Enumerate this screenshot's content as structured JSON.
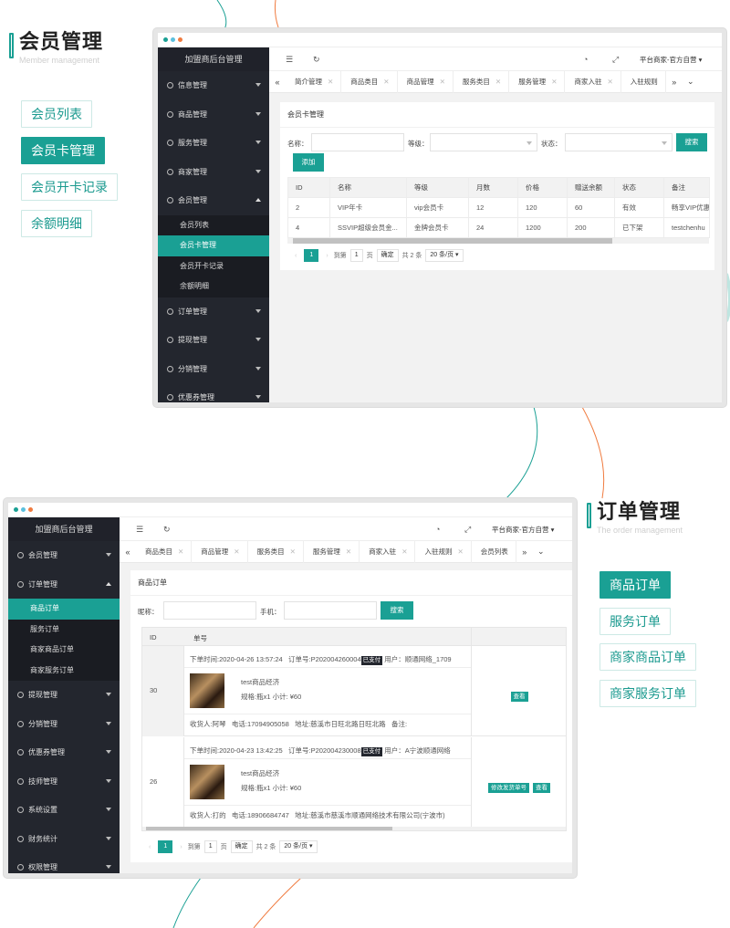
{
  "section1": {
    "title": "会员管理",
    "subtitle": "Member management",
    "tags": [
      "会员列表",
      "会员卡管理",
      "会员开卡记录",
      "余额明细"
    ]
  },
  "section2": {
    "title": "订单管理",
    "subtitle": "The order management",
    "tags": [
      "商品订单",
      "服务订单",
      "商家商品订单",
      "商家服务订单"
    ]
  },
  "colors": {
    "accent": "#1aa094",
    "sidebar": "#23262e",
    "orange": "#f07b3f"
  },
  "win1": {
    "brand": "加盟商后台管理",
    "nav": [
      "信息管理",
      "商品管理",
      "服务管理",
      "商家管理",
      "会员管理"
    ],
    "sub": [
      "会员列表",
      "会员卡管理",
      "会员开卡记录",
      "余额明细"
    ],
    "nav2": [
      "订单管理",
      "提现管理",
      "分销管理",
      "优惠券管理"
    ],
    "user": "平台商家-官方自营",
    "tabs": [
      "简介管理",
      "商品类目",
      "商品管理",
      "服务类目",
      "服务管理",
      "商家入驻",
      "入驻规则"
    ],
    "panel_title": "会员卡管理",
    "labels": {
      "name": "名称：",
      "level": "等级：",
      "status": "状态：",
      "search": "搜索",
      "add": "添加"
    },
    "table": {
      "headers": [
        "ID",
        "名称",
        "等级",
        "月数",
        "价格",
        "赠送余额",
        "状态",
        "备注"
      ],
      "rows": [
        [
          "2",
          "VIP年卡",
          "vip会员卡",
          "12",
          "120",
          "60",
          "有效",
          "畅享VIP优惠"
        ],
        [
          "4",
          "SSVIP超级会员金...",
          "金牌会员卡",
          "24",
          "1200",
          "200",
          "已下架",
          "testchenhu"
        ]
      ]
    },
    "pager": {
      "page": "1",
      "goto": "到第",
      "page_input": "1",
      "page_unit": "页",
      "confirm": "确定",
      "total": "共 2 条",
      "per": "20 条/页"
    }
  },
  "win2": {
    "brand": "加盟商后台管理",
    "nav": [
      "会员管理",
      "订单管理"
    ],
    "sub": [
      "商品订单",
      "服务订单",
      "商家商品订单",
      "商家服务订单"
    ],
    "nav2": [
      "提现管理",
      "分销管理",
      "优惠券管理",
      "技师管理",
      "系统设置",
      "财务统计",
      "权限管理"
    ],
    "user": "平台商家-官方自营",
    "tabs": [
      "商品类目",
      "商品管理",
      "服务类目",
      "服务管理",
      "商家入驻",
      "入驻规则",
      "会员列表"
    ],
    "panel_title": "商品订单",
    "labels": {
      "nick": "昵称：",
      "phone": "手机：",
      "search": "搜索"
    },
    "headers": [
      "ID",
      "单号"
    ],
    "orders": [
      {
        "id": "30",
        "time": "下单时间:2020-04-26 13:57:24",
        "no": "订单号:P202004260004",
        "paid": "已支付",
        "user": "用户：顺通网络_1709",
        "product": "test商品经济",
        "spec": "规格:瓶x1 小计: ¥60",
        "receiver": "收货人:阿琴",
        "tel": "电话:17094905058",
        "addr": "地址:慈溪市日旺北路日旺北路",
        "note": "备注:",
        "btns": [
          "查看"
        ]
      },
      {
        "id": "26",
        "time": "下单时间:2020-04-23 13:42:25",
        "no": "订单号:P202004230008",
        "paid": "已支付",
        "user": "用户：A宁波顺通网络",
        "product": "test商品经济",
        "spec": "规格:瓶x1 小计: ¥60",
        "receiver": "收货人:打的",
        "tel": "电话:18906684747",
        "addr": "地址:慈溪市慈溪市顺通网络技术有限公司(宁波市)",
        "note": "",
        "btns": [
          "修改发货单号",
          "查看"
        ]
      }
    ],
    "pager": {
      "page": "1",
      "goto": "到第",
      "page_input": "1",
      "page_unit": "页",
      "confirm": "确定",
      "total": "共 2 条",
      "per": "20 条/页"
    }
  }
}
